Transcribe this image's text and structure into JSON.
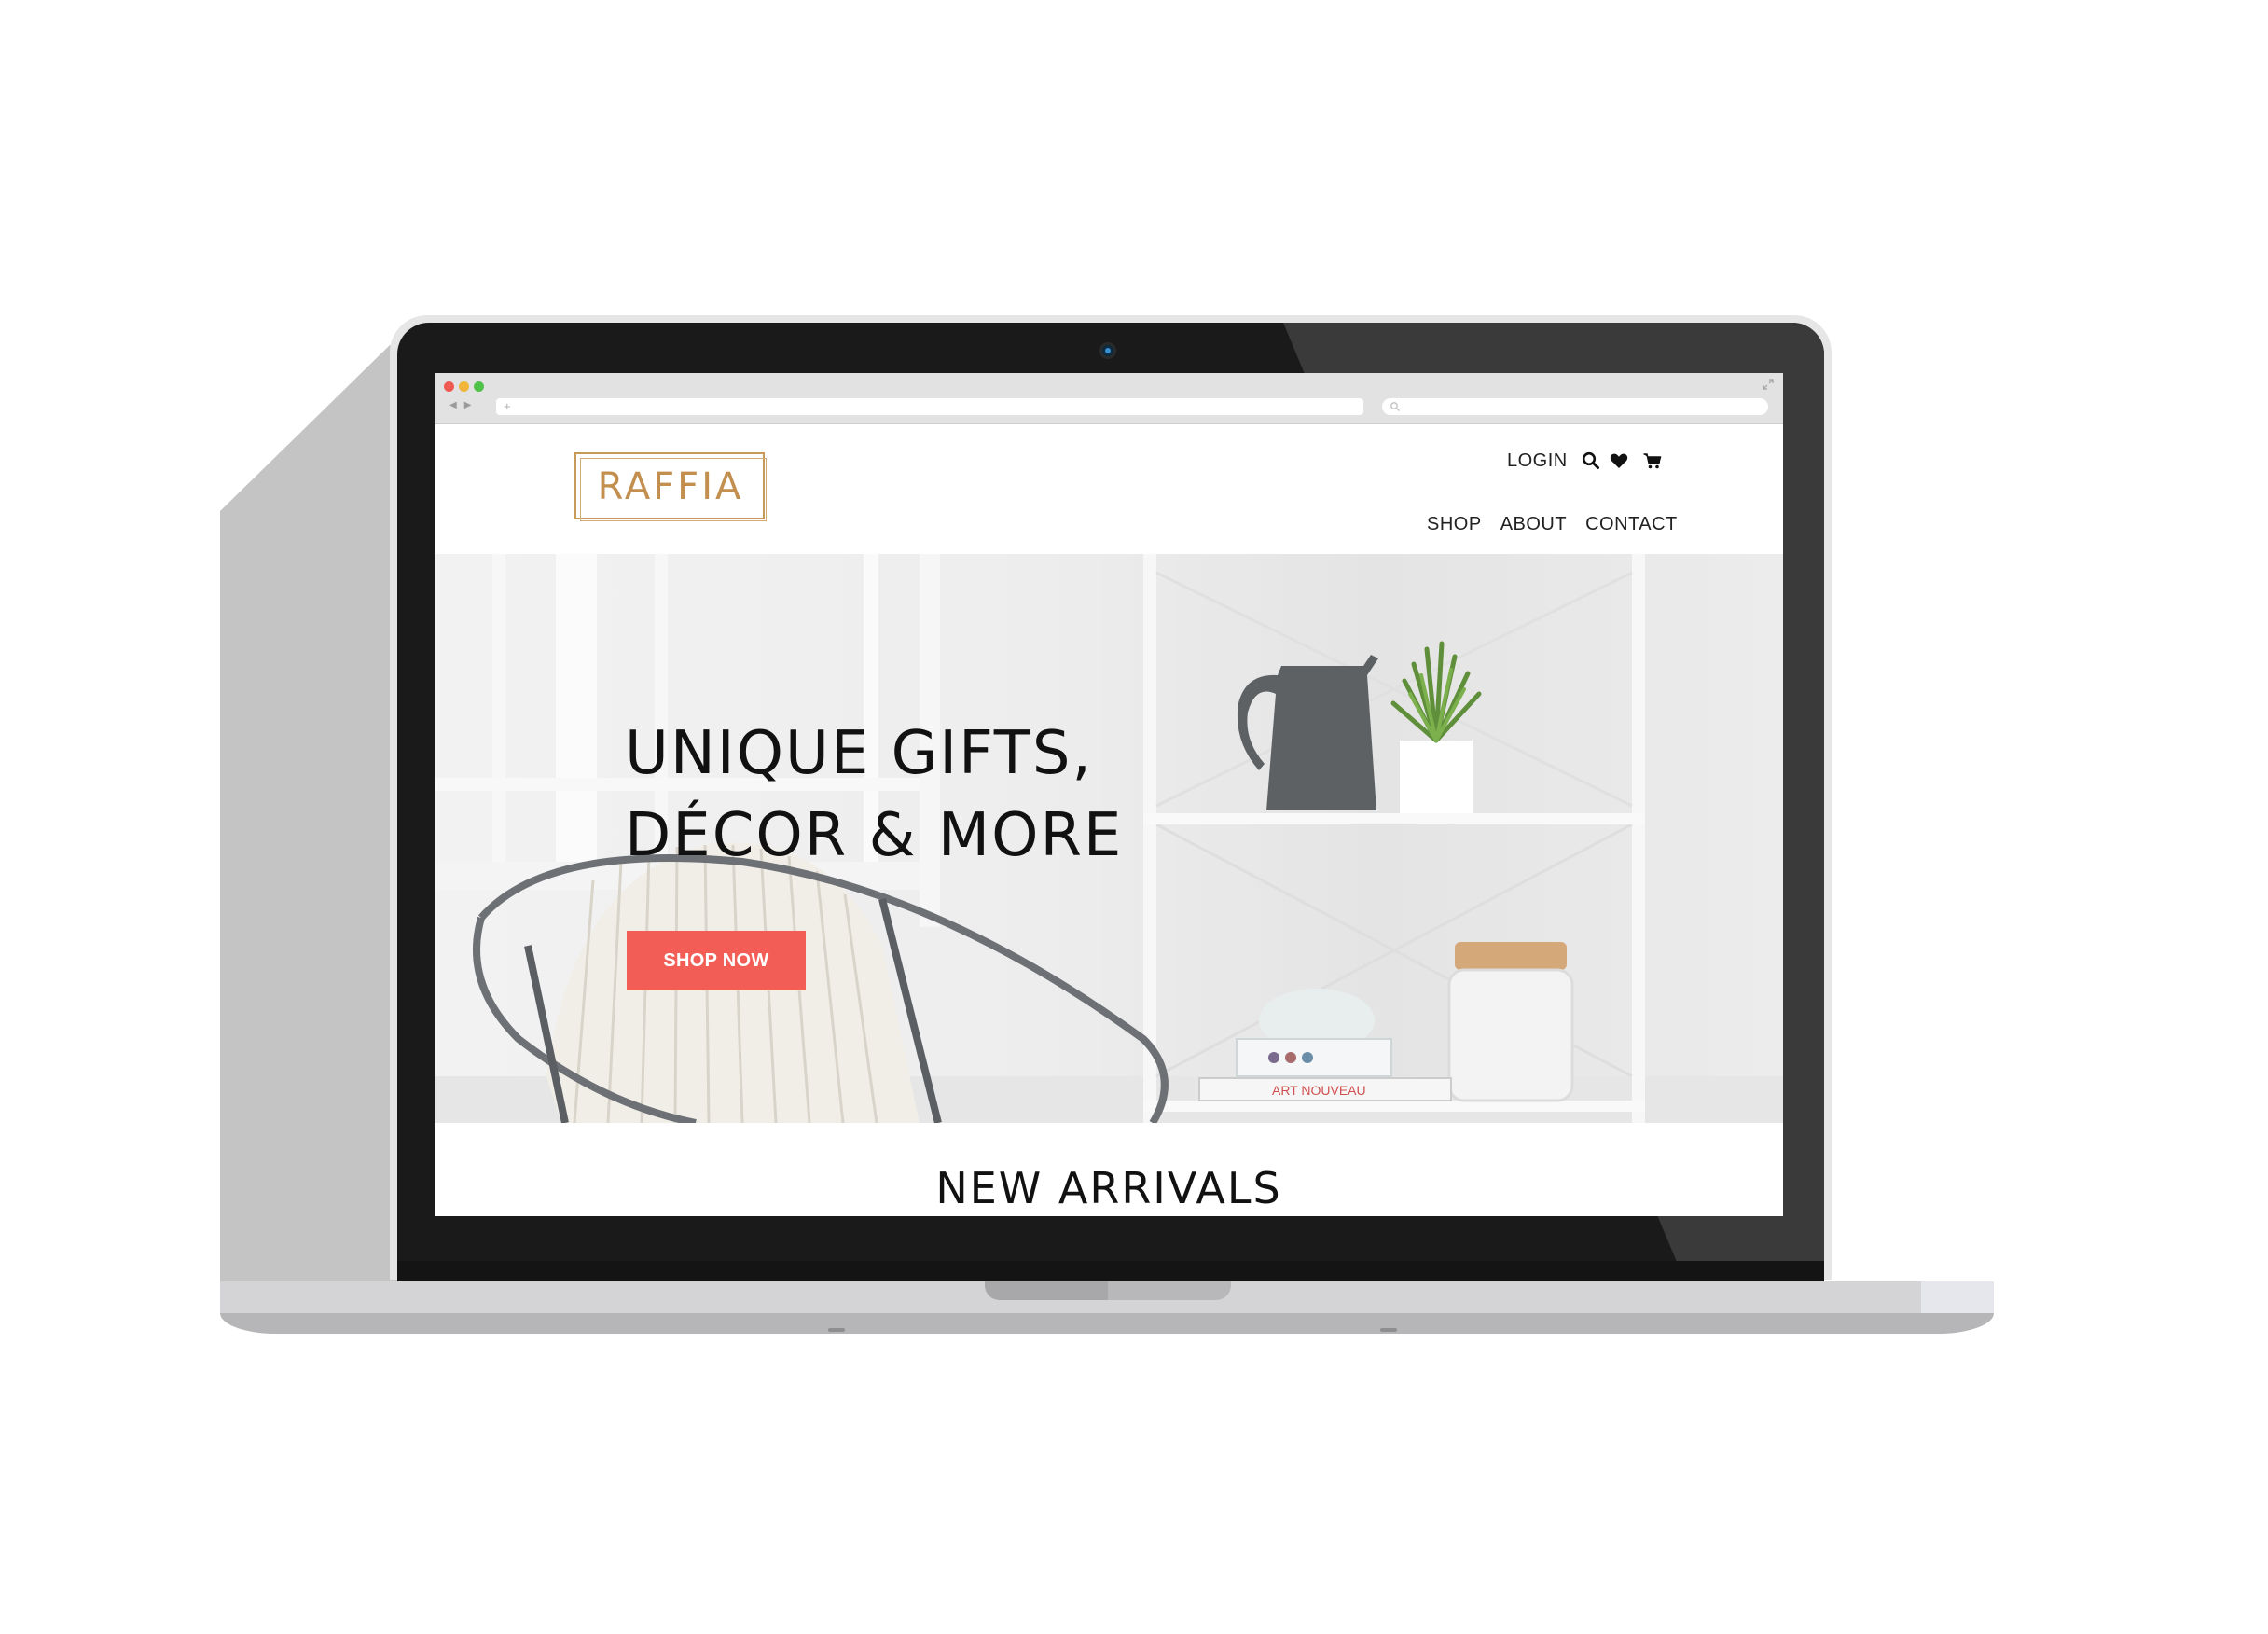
{
  "browser": {
    "traffic_colors": [
      "#ee5a52",
      "#f2b53c",
      "#4fc24a"
    ],
    "url_placeholder": "+",
    "back_icon": "back-arrow-icon",
    "forward_icon": "forward-arrow-icon"
  },
  "site": {
    "logo_text": "RAFFIA",
    "brand_color": "#c28f4f",
    "util_nav": {
      "login": "LOGIN",
      "icons": [
        "search-icon",
        "heart-icon",
        "cart-icon"
      ]
    },
    "main_nav": [
      "SHOP",
      "ABOUT",
      "CONTACT"
    ]
  },
  "hero": {
    "headline_line1": "UNIQUE GIFTS,",
    "headline_line2": "DÉCOR & MORE",
    "cta_label": "SHOP NOW",
    "cta_color": "#f25e55",
    "book_title": "ART NOUVEAU"
  },
  "sections": {
    "new_arrivals": "NEW ARRIVALS"
  }
}
